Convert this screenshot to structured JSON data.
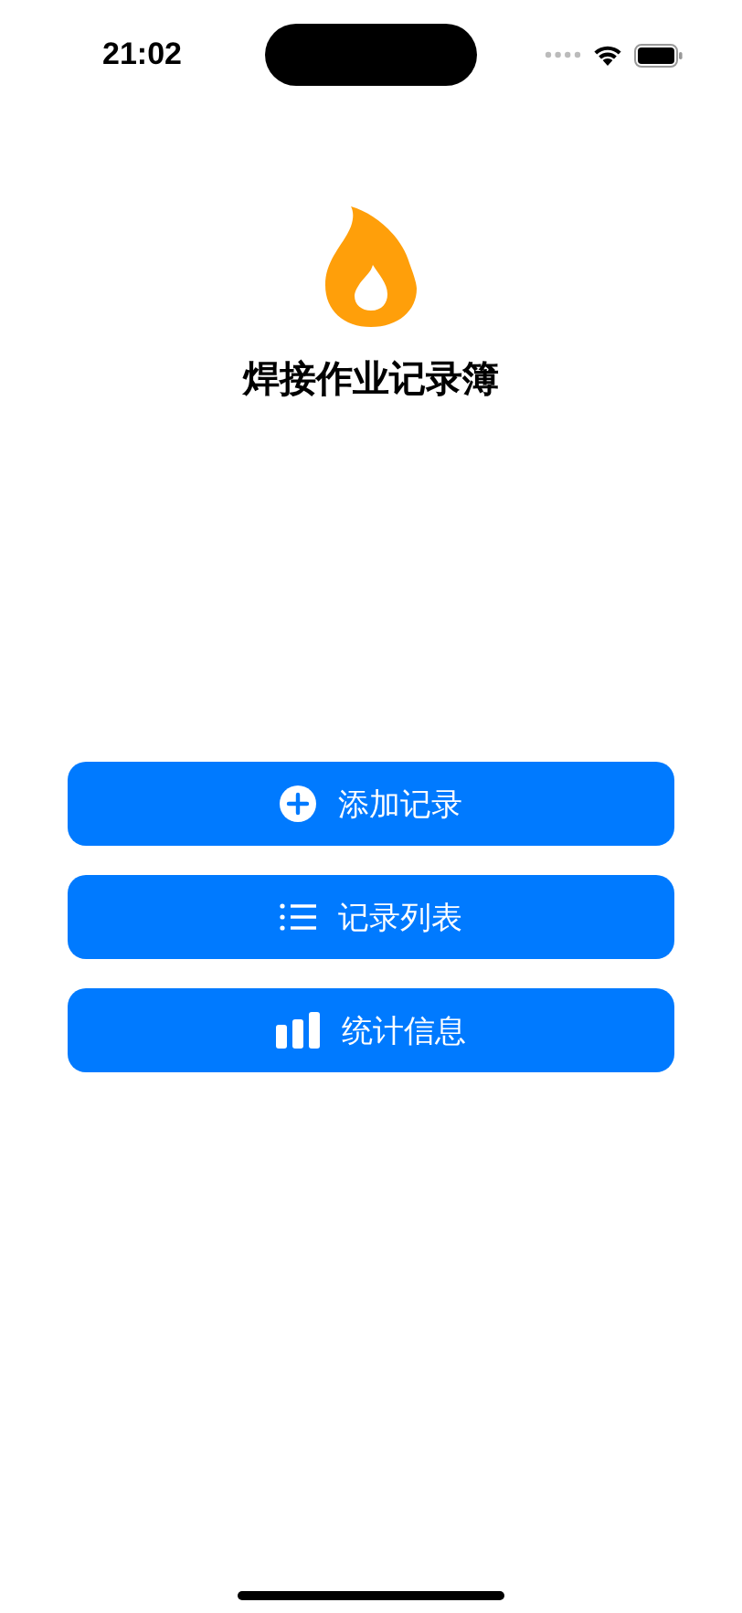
{
  "status_bar": {
    "time": "21:02"
  },
  "header": {
    "title": "焊接作业记录簿"
  },
  "buttons": [
    {
      "label": "添加记录",
      "kind": "plus"
    },
    {
      "label": "记录列表",
      "kind": "list"
    },
    {
      "label": "统计信息",
      "kind": "bars"
    }
  ]
}
